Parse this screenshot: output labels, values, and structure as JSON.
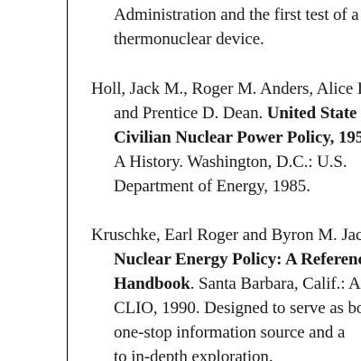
{
  "entries": [
    {
      "lines": [
        "Administration and the first test of a",
        "thermonuclear device."
      ]
    },
    {
      "lines": [
        {
          "plain": "Holl, Jack M., Roger M. Anders, Alice L"
        },
        {
          "plain": "and Prentice D. Dean.  ",
          "bold": "United State"
        },
        {
          "bold": "Civilian Nuclear Power Policy, 195"
        },
        {
          "plain": "A History. Washington, D.C.: U.S."
        },
        {
          "plain": "Department of Energy, 1985."
        }
      ]
    },
    {
      "lines": [
        {
          "plain": "Kruschke, Earl Roger and Byron M. Jac"
        },
        {
          "bold": "Nuclear Energy Policy: A Referenc"
        },
        {
          "bold": "Handbook",
          "plain_after": ". Santa Barbara, Calif.: A"
        },
        {
          "plain": "CLIO, 1990. Designed to serve as bo"
        },
        {
          "plain": "one-stop information source and a"
        },
        {
          "plain": "to in-depth exploration."
        }
      ]
    }
  ]
}
